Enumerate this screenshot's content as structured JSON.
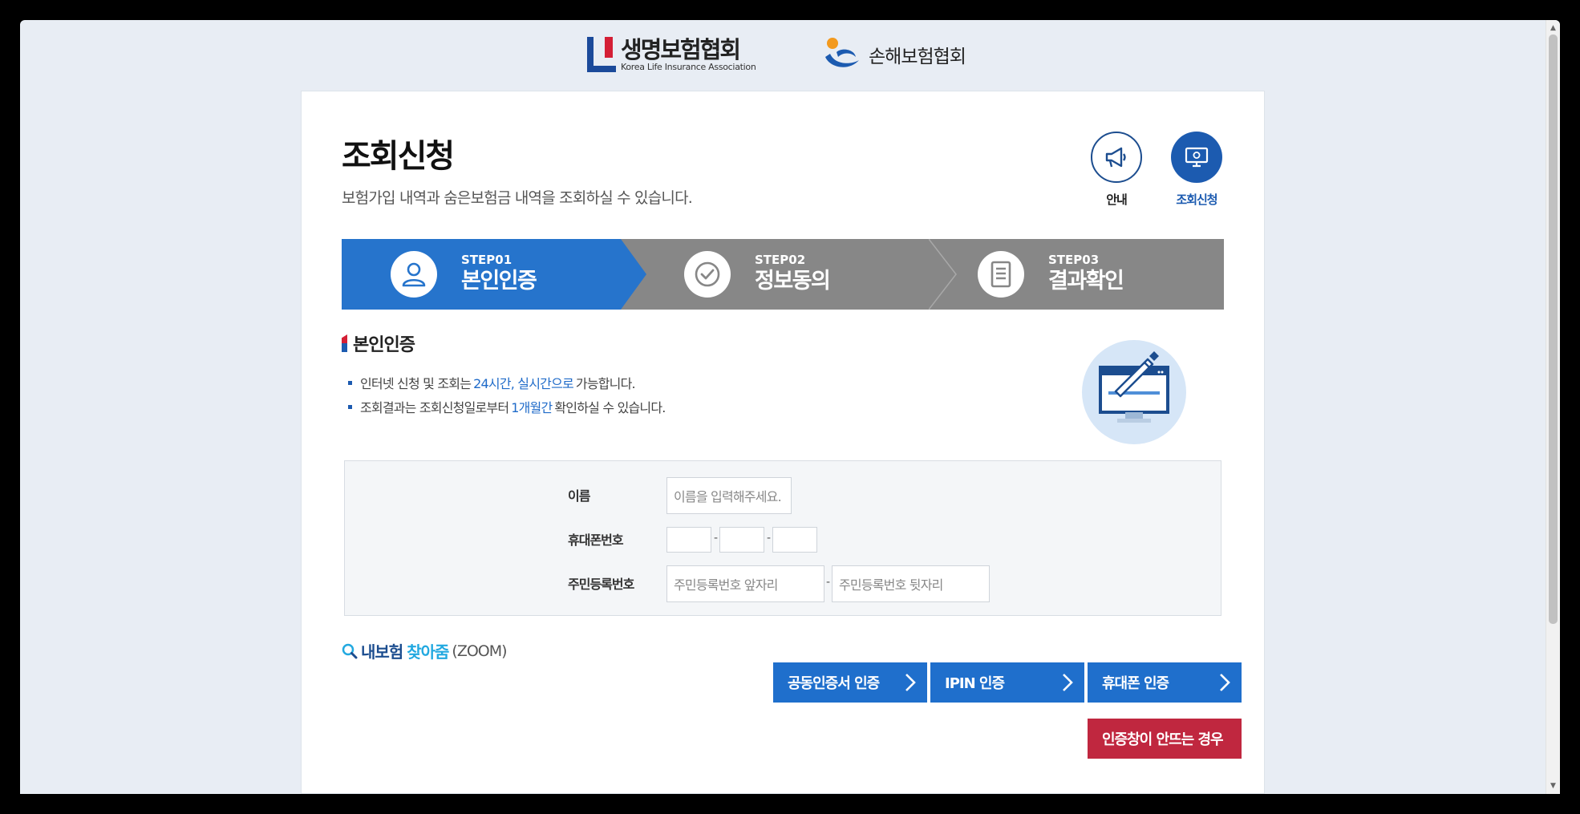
{
  "logos": {
    "life_name": "생명보험협회",
    "life_en": "Korea Life Insurance Association",
    "nonlife_name": "손해보험협회"
  },
  "page": {
    "title": "조회신청",
    "subtitle": "보험가입 내역과 숨은보험금 내역을 조회하실 수 있습니다."
  },
  "quick": {
    "guide_label": "안내",
    "apply_label": "조회신청"
  },
  "steps": [
    {
      "no": "STEP01",
      "name": "본인인증"
    },
    {
      "no": "STEP02",
      "name": "정보동의"
    },
    {
      "no": "STEP03",
      "name": "결과확인"
    }
  ],
  "section": {
    "title": "본인인증",
    "bullet1_pre": "인터넷 신청 및 조회는",
    "bullet1_hl": "24시간, 실시간으로",
    "bullet1_post": "가능합니다.",
    "bullet2_pre": "조회결과는 조회신청일로부터",
    "bullet2_hl": "1개월간",
    "bullet2_post": "확인하실 수 있습니다."
  },
  "form": {
    "name_label": "이름",
    "name_placeholder": "이름을 입력해주세요.",
    "phone_label": "휴대폰번호",
    "phone_dash": "-",
    "rrn_label": "주민등록번호",
    "rrn_front_placeholder": "주민등록번호 앞자리",
    "rrn_back_placeholder": "주민등록번호 뒷자리",
    "rrn_dash": "-"
  },
  "zoom": {
    "part1": "내보험",
    "part2": "찾아줌",
    "part3": "(ZOOM)"
  },
  "buttons": {
    "cert": "공동인증서 인증",
    "ipin": "IPIN 인증",
    "phone": "휴대폰 인증",
    "fail": "인증창이 안뜨는 경우"
  },
  "colors": {
    "primary_blue": "#2674cc",
    "step_gray": "#878787",
    "button_blue": "#1f6fcc",
    "fail_red": "#c0273f",
    "highlight_blue": "#1f6bc9"
  }
}
